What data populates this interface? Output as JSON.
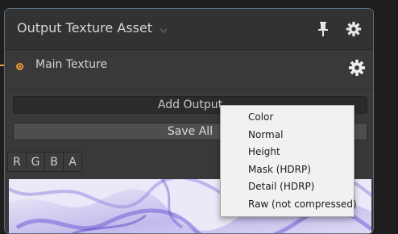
{
  "node": {
    "title": "Output Texture Asset",
    "accent_color": "#e99a3c",
    "border_color": "#5e6f80"
  },
  "header_icons": [
    "chevron-down-icon",
    "pin-icon",
    "gear-icon"
  ],
  "output_row": {
    "label": "Main Texture"
  },
  "buttons": {
    "add_output": "Add Output",
    "save_all": "Save All"
  },
  "channels": [
    "R",
    "G",
    "B",
    "A"
  ],
  "dropdown": {
    "items": [
      "Color",
      "Normal",
      "Height",
      "Mask (HDRP)",
      "Detail (HDRP)",
      "Raw (not compressed)"
    ]
  }
}
